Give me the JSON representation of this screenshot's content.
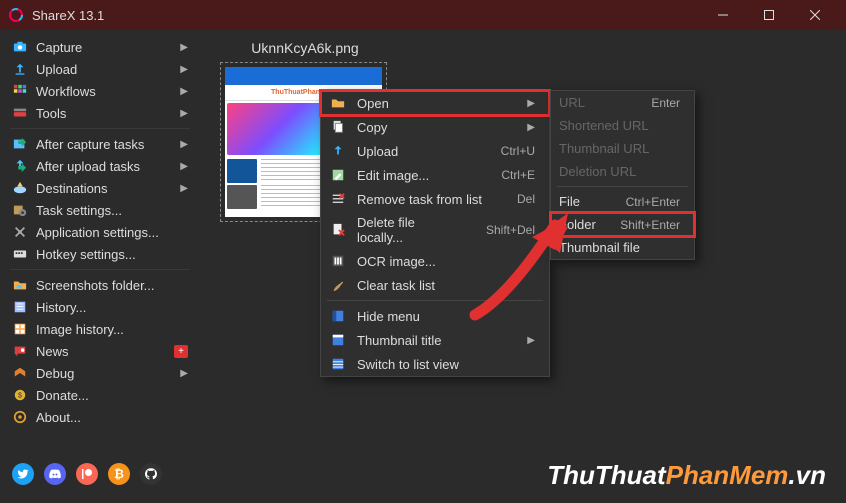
{
  "window": {
    "title": "ShareX 13.1"
  },
  "sidebar": {
    "groups": [
      [
        {
          "label": "Capture",
          "arrow": true
        },
        {
          "label": "Upload",
          "arrow": true
        },
        {
          "label": "Workflows",
          "arrow": true
        },
        {
          "label": "Tools",
          "arrow": true
        }
      ],
      [
        {
          "label": "After capture tasks",
          "arrow": true
        },
        {
          "label": "After upload tasks",
          "arrow": true
        },
        {
          "label": "Destinations",
          "arrow": true
        },
        {
          "label": "Task settings..."
        },
        {
          "label": "Application settings..."
        },
        {
          "label": "Hotkey settings..."
        }
      ],
      [
        {
          "label": "Screenshots folder..."
        },
        {
          "label": "History..."
        },
        {
          "label": "Image history..."
        },
        {
          "label": "News",
          "badge": "+"
        },
        {
          "label": "Debug",
          "arrow": true
        },
        {
          "label": "Donate..."
        },
        {
          "label": "About..."
        }
      ]
    ]
  },
  "file": {
    "name": "UknnKcyA6k.png"
  },
  "context_menu": {
    "items": [
      {
        "label": "Open",
        "arrow": true,
        "highlight": true
      },
      {
        "label": "Copy",
        "arrow": true
      },
      {
        "label": "Upload",
        "shortcut": "Ctrl+U"
      },
      {
        "label": "Edit image...",
        "shortcut": "Ctrl+E"
      },
      {
        "label": "Remove task from list",
        "shortcut": "Del"
      },
      {
        "label": "Delete file locally...",
        "shortcut": "Shift+Del"
      },
      {
        "label": "OCR image..."
      },
      {
        "label": "Clear task list"
      },
      {
        "sep": true
      },
      {
        "label": "Hide menu"
      },
      {
        "label": "Thumbnail title",
        "arrow": true
      },
      {
        "label": "Switch to list view"
      }
    ]
  },
  "submenu": {
    "items": [
      {
        "label": "URL",
        "shortcut": "Enter",
        "disabled": true
      },
      {
        "label": "Shortened URL",
        "disabled": true
      },
      {
        "label": "Thumbnail URL",
        "disabled": true
      },
      {
        "label": "Deletion URL",
        "disabled": true
      },
      {
        "sep": true
      },
      {
        "label": "File",
        "shortcut": "Ctrl+Enter"
      },
      {
        "label": "Folder",
        "shortcut": "Shift+Enter",
        "highlight": true
      },
      {
        "label": "Thumbnail file"
      }
    ]
  },
  "watermark": {
    "part1": "ThuThuat",
    "part2": "PhanMem",
    "part3": ".vn"
  },
  "icons": {
    "camera": "#39b4ff",
    "upload": "#39b4ff",
    "workflows": "#ff5ab0",
    "tools": "#e04040",
    "aftercap": "#58c0ff",
    "afterup": "#58c0ff",
    "dest": "#ffd060",
    "task": "#c09a5a",
    "app": "#aaa",
    "hotkey": "#ddd",
    "folder": "#f0b050",
    "history": "#a0c0ff",
    "imghist": "#ffb060",
    "news": "#e04040",
    "debug": "#e08030",
    "donate": "#e0b030",
    "about": "#e0a030"
  }
}
